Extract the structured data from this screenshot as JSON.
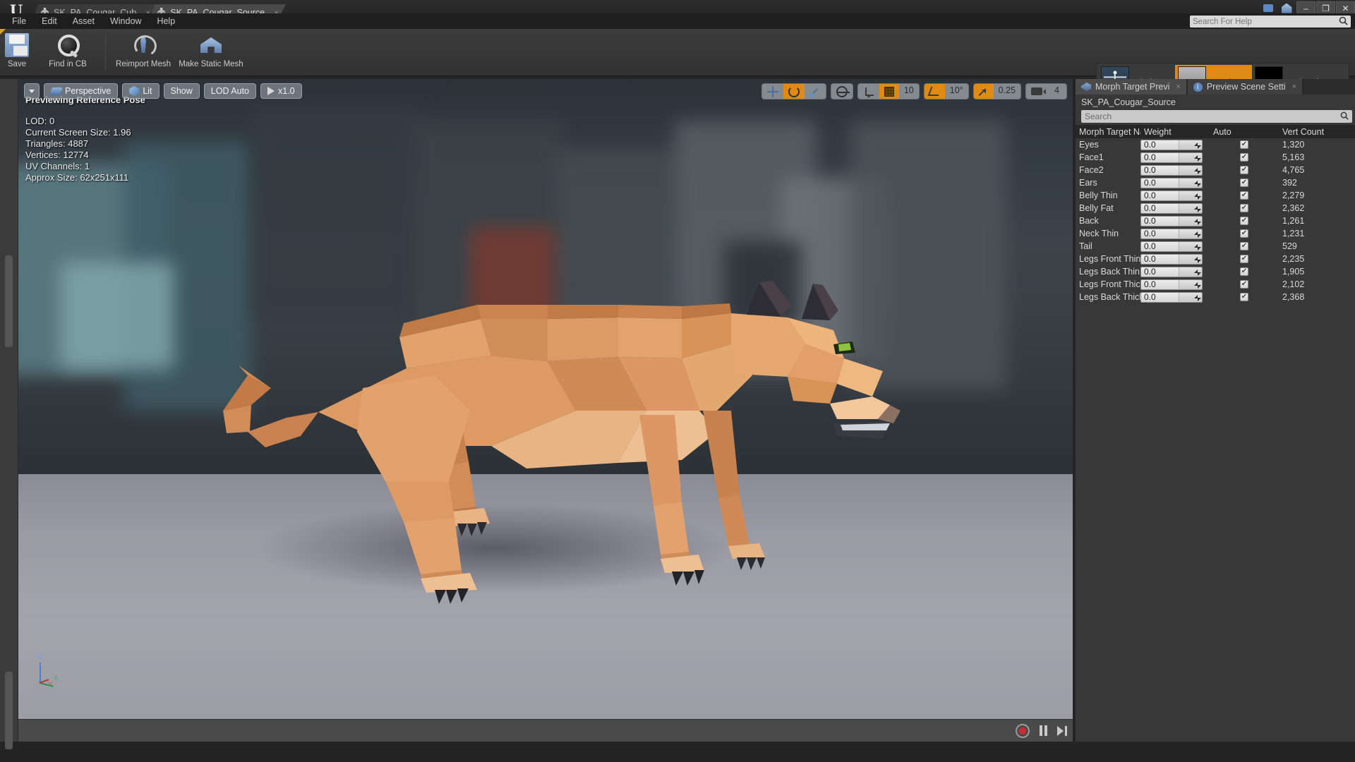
{
  "app": {
    "logo": "U",
    "help_search_placeholder": "Search For Help"
  },
  "titlebar": {
    "tabs": [
      {
        "label": "SK_PA_Cougar_Cub",
        "active": false,
        "close": "×"
      },
      {
        "label": "SK_PA_Cougar_Source",
        "active": true,
        "close": "×"
      }
    ],
    "window_buttons": {
      "minimize": "–",
      "restore": "❐",
      "close": "✕"
    }
  },
  "menubar": {
    "items": [
      "File",
      "Edit",
      "Asset",
      "Window",
      "Help"
    ]
  },
  "toolbar": {
    "buttons": [
      {
        "label": "Save",
        "icon": "floppy-disk-icon"
      },
      {
        "label": "Find in CB",
        "icon": "magnifier-icon"
      },
      {
        "label": "Reimport Mesh",
        "icon": "reimport-figure-icon"
      },
      {
        "label": "Make Static Mesh",
        "icon": "house-mesh-icon"
      }
    ]
  },
  "modes": [
    {
      "label": "Skeleton",
      "active": false,
      "has_caret": false
    },
    {
      "label": "Mesh",
      "active": true,
      "has_caret": true
    },
    {
      "label": "Animation",
      "active": false,
      "has_caret": true
    }
  ],
  "viewport": {
    "toolbar_left": [
      {
        "label": "",
        "icon": "chevron-down-icon"
      },
      {
        "label": "Perspective",
        "icon": "perspective-icon"
      },
      {
        "label": "Lit",
        "icon": "cube-icon"
      },
      {
        "label": "Show",
        "icon": ""
      },
      {
        "label": "LOD Auto",
        "icon": ""
      },
      {
        "label": "x1.0",
        "icon": "play-icon"
      }
    ],
    "toolbar_right": {
      "transform_modes": [
        {
          "name": "move-mode",
          "active": false
        },
        {
          "name": "rotate-mode",
          "active": true
        },
        {
          "name": "scale-mode",
          "active": false
        }
      ],
      "world_space": {
        "name": "world-coordinate-toggle",
        "active": false
      },
      "snaps": [
        {
          "name": "surface-snap-toggle",
          "active": false,
          "value": ""
        },
        {
          "name": "grid-snap-toggle",
          "active": true,
          "value": "10"
        },
        {
          "name": "rotation-snap-toggle",
          "active": true,
          "value": "10°"
        },
        {
          "name": "scale-snap-toggle",
          "active": true,
          "value": "0.25"
        },
        {
          "name": "camera-speed",
          "active": false,
          "value": "4"
        }
      ]
    },
    "status_header": "Previewing Reference Pose",
    "stats": [
      "LOD: 0",
      "Current Screen Size: 1.96",
      "Triangles: 4887",
      "Vertices: 12774",
      "UV Channels: 1",
      "Approx Size: 62x251x111"
    ],
    "axis_labels": {
      "z": "Z",
      "x": "X",
      "y": "Y"
    }
  },
  "playback": {
    "record": "record-button",
    "pause": "pause-button",
    "step": "step-forward-button"
  },
  "right_panel": {
    "tabs": [
      {
        "label": "Morph Target Previ",
        "icon": "morph-icon",
        "active": true,
        "close": "×"
      },
      {
        "label": "Preview Scene Setti",
        "icon": "info-icon",
        "active": false,
        "close": "×"
      }
    ],
    "asset_name": "SK_PA_Cougar_Source",
    "search_placeholder": "Search",
    "columns": [
      "Morph Target Na",
      "Weight",
      "Auto",
      "Vert Count"
    ],
    "rows": [
      {
        "name": "Eyes",
        "weight": "0.0",
        "auto": true,
        "vert_count": "1,320"
      },
      {
        "name": "Face1",
        "weight": "0.0",
        "auto": true,
        "vert_count": "5,163"
      },
      {
        "name": "Face2",
        "weight": "0.0",
        "auto": true,
        "vert_count": "4,765"
      },
      {
        "name": "Ears",
        "weight": "0.0",
        "auto": true,
        "vert_count": "392"
      },
      {
        "name": "Belly Thin",
        "weight": "0.0",
        "auto": true,
        "vert_count": "2,279"
      },
      {
        "name": "Belly Fat",
        "weight": "0.0",
        "auto": true,
        "vert_count": "2,362"
      },
      {
        "name": "Back",
        "weight": "0.0",
        "auto": true,
        "vert_count": "1,261"
      },
      {
        "name": "Neck Thin",
        "weight": "0.0",
        "auto": true,
        "vert_count": "1,231"
      },
      {
        "name": "Tail",
        "weight": "0.0",
        "auto": true,
        "vert_count": "529"
      },
      {
        "name": "Legs Front Thin",
        "weight": "0.0",
        "auto": true,
        "vert_count": "2,235"
      },
      {
        "name": "Legs Back Thin",
        "weight": "0.0",
        "auto": true,
        "vert_count": "1,905"
      },
      {
        "name": "Legs Front Thick",
        "weight": "0.0",
        "auto": true,
        "vert_count": "2,102"
      },
      {
        "name": "Legs Back Thick",
        "weight": "0.0",
        "auto": true,
        "vert_count": "2,368"
      }
    ]
  },
  "colors": {
    "accent_orange": "#e08a12",
    "panel_bg": "#383838",
    "toolbar_bg": "#3c3c3c",
    "text": "#d9d9d9"
  }
}
